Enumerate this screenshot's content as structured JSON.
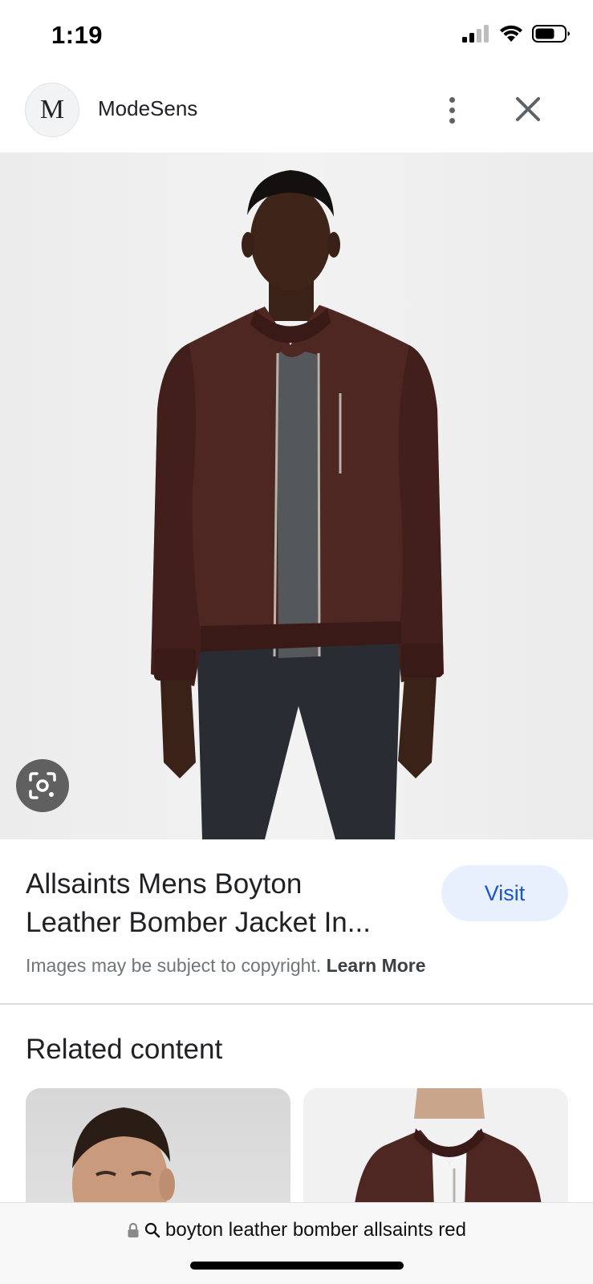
{
  "status_bar": {
    "time": "1:19",
    "icons": [
      "signal-icon",
      "wifi-icon",
      "battery-icon"
    ]
  },
  "header": {
    "favicon_letter": "M",
    "site_name": "ModeSens",
    "icons": [
      "more-vert-icon",
      "close-icon"
    ]
  },
  "hero": {
    "icons": [
      "lens-search-icon"
    ]
  },
  "result": {
    "title_line1": "Allsaints Mens Boyton",
    "title_line2": "Leather Bomber Jacket In...",
    "visit_label": "Visit",
    "copyright_text": "Images may be subject to copyright.",
    "learn_more_label": "Learn More"
  },
  "related": {
    "heading": "Related content"
  },
  "url_bar": {
    "query": "boyton leather bomber allsaints red",
    "icons": [
      "lock-icon",
      "search-icon"
    ]
  },
  "colors": {
    "visit_bg": "#e8f0fe",
    "visit_text": "#1a56c9",
    "jacket": "#4e2622"
  }
}
